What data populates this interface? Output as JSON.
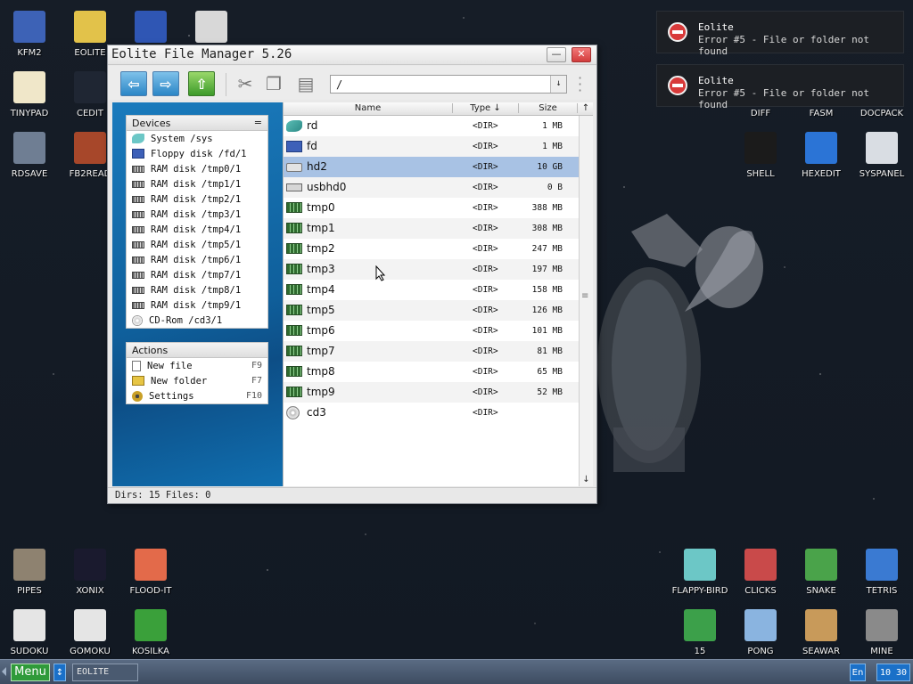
{
  "desktop_icons_left": [
    {
      "label": "KFM2",
      "icon": "floppy-icon",
      "color": "#3d62b6"
    },
    {
      "label": "EOLITE",
      "icon": "folder-icon",
      "color": "#e2c24a"
    },
    {
      "label": "",
      "icon": "form-icon",
      "color": "#2f56b4"
    },
    {
      "label": "",
      "icon": "calculator-icon",
      "color": "#d8d8d8"
    },
    {
      "label": "TINYPAD",
      "icon": "notepad-icon",
      "color": "#f0e7c9"
    },
    {
      "label": "CEDIT",
      "icon": "code-icon",
      "color": "#1f2633"
    },
    {
      "label": "RDSAVE",
      "icon": "ram-save-icon",
      "color": "#6f7e93"
    },
    {
      "label": "FB2READ",
      "icon": "book-icon",
      "color": "#a7472a"
    }
  ],
  "desktop_icons_right": [
    {
      "label": "DIFF",
      "icon": "diff-icon",
      "color": "#444"
    },
    {
      "label": "FASM",
      "icon": "fasm-icon",
      "color": "#444"
    },
    {
      "label": "DOCPACK",
      "icon": "docpack-icon",
      "color": "#444"
    },
    {
      "label": "SHELL",
      "icon": "shell-icon",
      "color": "#1b1b1b"
    },
    {
      "label": "HEXEDIT",
      "icon": "hexedit-icon",
      "color": "#2b74d6"
    },
    {
      "label": "SYSPANEL",
      "icon": "sliders-icon",
      "color": "#d9dde3"
    }
  ],
  "desktop_icons_bottom_left": [
    {
      "label": "PIPES",
      "icon": "pipes-icon",
      "color": "#8e8270"
    },
    {
      "label": "XONIX",
      "icon": "xonix-icon",
      "color": "#1a1a2e"
    },
    {
      "label": "FLOOD-IT",
      "icon": "flood-icon",
      "color": "#e36a4a"
    },
    {
      "label": "SUDOKU",
      "icon": "sudoku-icon",
      "color": "#e5e5e5"
    },
    {
      "label": "GOMOKU",
      "icon": "gomoku-icon",
      "color": "#e5e5e5"
    },
    {
      "label": "KOSILKA",
      "icon": "lawnmower-icon",
      "color": "#3aa03a"
    }
  ],
  "desktop_icons_bottom_right": [
    {
      "label": "FLAPPY-BIRD",
      "icon": "bird-icon",
      "color": "#6cc7c6"
    },
    {
      "label": "CLICKS",
      "icon": "clicks-icon",
      "color": "#c94a4a"
    },
    {
      "label": "SNAKE",
      "icon": "snake-icon",
      "color": "#4aa34a"
    },
    {
      "label": "TETRIS",
      "icon": "tetris-icon",
      "color": "#3a7ad2"
    },
    {
      "label": "15",
      "icon": "fifteen-icon",
      "color": "#3ca04a"
    },
    {
      "label": "PONG",
      "icon": "pong-icon",
      "color": "#8ab4e0"
    },
    {
      "label": "SEAWAR",
      "icon": "ship-icon",
      "color": "#c89a5a"
    },
    {
      "label": "MINE",
      "icon": "mine-icon",
      "color": "#8a8a8a"
    }
  ],
  "notifications": [
    {
      "title": "Eolite",
      "message": "Error #5 - File or folder not found"
    },
    {
      "title": "Eolite",
      "message": "Error #5 - File or folder not found"
    }
  ],
  "window": {
    "title": "Eolite File Manager 5.26",
    "minimize_label": "—",
    "close_label": "✕",
    "path_value": "/",
    "status_text": "Dirs: 15  Files: 0"
  },
  "devices_panel": {
    "title": "Devices",
    "menu_glyph": "=",
    "items": [
      {
        "label": "System /sys",
        "icon": "bird"
      },
      {
        "label": "Floppy disk /fd/1",
        "icon": "flop"
      },
      {
        "label": "RAM disk /tmp0/1",
        "icon": "ram"
      },
      {
        "label": "RAM disk /tmp1/1",
        "icon": "ram"
      },
      {
        "label": "RAM disk /tmp2/1",
        "icon": "ram"
      },
      {
        "label": "RAM disk /tmp3/1",
        "icon": "ram"
      },
      {
        "label": "RAM disk /tmp4/1",
        "icon": "ram"
      },
      {
        "label": "RAM disk /tmp5/1",
        "icon": "ram"
      },
      {
        "label": "RAM disk /tmp6/1",
        "icon": "ram"
      },
      {
        "label": "RAM disk /tmp7/1",
        "icon": "ram"
      },
      {
        "label": "RAM disk /tmp8/1",
        "icon": "ram"
      },
      {
        "label": "RAM disk /tmp9/1",
        "icon": "ram"
      },
      {
        "label": "CD-Rom /cd3/1",
        "icon": "cd"
      }
    ]
  },
  "actions_panel": {
    "title": "Actions",
    "items": [
      {
        "label": "New file",
        "key": "F9",
        "icon": "file"
      },
      {
        "label": "New folder",
        "key": "F7",
        "icon": "folder"
      },
      {
        "label": "Settings",
        "key": "F10",
        "icon": "gear"
      }
    ]
  },
  "columns": {
    "name": "Name",
    "type": "Type ↓",
    "size": "Size",
    "scroll_up": "↑"
  },
  "files": [
    {
      "name": "rd",
      "type": "<DIR>",
      "size": "1 MB",
      "icon": "bird"
    },
    {
      "name": "fd",
      "type": "<DIR>",
      "size": "1 MB",
      "icon": "flop"
    },
    {
      "name": "hd2",
      "type": "<DIR>",
      "size": "10 GB",
      "icon": "hd",
      "selected": true
    },
    {
      "name": "usbhd0",
      "type": "<DIR>",
      "size": "0 B",
      "icon": "usb"
    },
    {
      "name": "tmp0",
      "type": "<DIR>",
      "size": "388 MB",
      "icon": "ram"
    },
    {
      "name": "tmp1",
      "type": "<DIR>",
      "size": "308 MB",
      "icon": "ram"
    },
    {
      "name": "tmp2",
      "type": "<DIR>",
      "size": "247 MB",
      "icon": "ram"
    },
    {
      "name": "tmp3",
      "type": "<DIR>",
      "size": "197 MB",
      "icon": "ram"
    },
    {
      "name": "tmp4",
      "type": "<DIR>",
      "size": "158 MB",
      "icon": "ram"
    },
    {
      "name": "tmp5",
      "type": "<DIR>",
      "size": "126 MB",
      "icon": "ram"
    },
    {
      "name": "tmp6",
      "type": "<DIR>",
      "size": "101 MB",
      "icon": "ram"
    },
    {
      "name": "tmp7",
      "type": "<DIR>",
      "size": "81 MB",
      "icon": "ram"
    },
    {
      "name": "tmp8",
      "type": "<DIR>",
      "size": "65 MB",
      "icon": "ram"
    },
    {
      "name": "tmp9",
      "type": "<DIR>",
      "size": "52 MB",
      "icon": "ram"
    },
    {
      "name": "cd3",
      "type": "<DIR>",
      "size": "",
      "icon": "cd"
    }
  ],
  "taskbar": {
    "menu_label": "Menu",
    "switcher_glyph": "↕",
    "task_label": "EOLITE",
    "lang": "En",
    "clock": "10 30"
  },
  "colors": {
    "accent_blue": "#1a7bbd",
    "selection": "#a8c2e4",
    "taskbar": "#4a5a70",
    "error_red": "#d83a3a"
  }
}
